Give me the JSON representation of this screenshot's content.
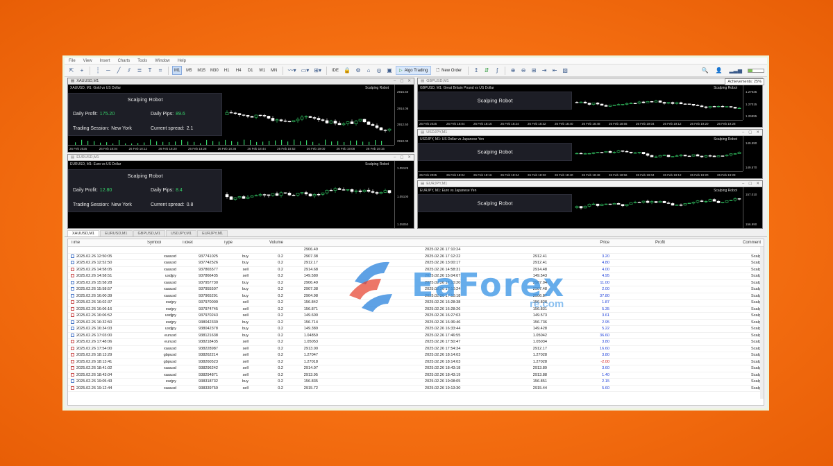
{
  "menu": [
    "File",
    "View",
    "Insert",
    "Charts",
    "Tools",
    "Window",
    "Help"
  ],
  "toolbar": {
    "timeframes": [
      "M1",
      "M5",
      "M15",
      "M30",
      "H1",
      "H4",
      "D1",
      "W1",
      "MN"
    ],
    "active_timeframe": "M1",
    "ide": "IDE",
    "algo_trading": "Algo Trading",
    "new_order": "New Order",
    "achievements_tooltip": "Achievements: 25%",
    "achievements_percent": 25
  },
  "charts": [
    {
      "window_title": "XAUUSD,M1",
      "symbol_line": "XAUUSD, M1: Gold vs US Dollar",
      "robot_tag": "Scalping Robot",
      "panel": {
        "title": "Scalping Robot",
        "daily_profit_label": "Daily Profit:",
        "daily_profit": "175.20",
        "daily_pips_label": "Daily Pips:",
        "daily_pips": "89.6",
        "session_label": "Trading Session:",
        "session": "New York",
        "spread_label": "Current spread:",
        "spread": "2.1"
      },
      "price_labels": [
        "2915.50",
        "2914.06",
        "2912.50",
        "2910.00"
      ],
      "time_labels": [
        "26 Feb 2025",
        "26 Feb 18:04",
        "26 Feb 18:12",
        "26 Feb 18:20",
        "26 Feb 18:28",
        "26 Feb 18:36",
        "26 Feb 18:44",
        "26 Feb 18:52",
        "26 Feb 19:00",
        "26 Feb 19:08",
        "26 Feb 19:16"
      ]
    },
    {
      "window_title": "EURUSD,M1",
      "symbol_line": "EURUSD, M1: Euro vs US Dollar",
      "robot_tag": "Scalping Robot",
      "panel": {
        "title": "Scalping Robot",
        "daily_profit_label": "Daily Profit:",
        "daily_profit": "12.80",
        "daily_pips_label": "Daily Pips:",
        "daily_pips": "8.4",
        "session_label": "Trading Session:",
        "session": "New York",
        "spread_label": "Current spread:",
        "spread": "0.8"
      },
      "price_labels": [
        "1.05125",
        "1.05100",
        "1.05050"
      ],
      "time_labels": []
    },
    {
      "window_title": "GBPUSD,M1",
      "symbol_line": "GBPUSD, M1: Great Britain Pound vs US Dollar",
      "robot_tag": "Scalping Robot",
      "panel": {
        "title": "Scalping Robot"
      },
      "price_labels": [
        "1.27035",
        "1.27015",
        "1.26995"
      ],
      "time_labels": [
        "26 Feb 2025",
        "26 Feb 18:04",
        "26 Feb 18:16",
        "26 Feb 18:24",
        "26 Feb 18:32",
        "26 Feb 18:40",
        "26 Feb 18:48",
        "26 Feb 18:56",
        "26 Feb 19:04",
        "26 Feb 19:12",
        "26 Feb 19:20",
        "26 Feb 19:28"
      ]
    },
    {
      "window_title": "USDJPY,M1",
      "symbol_line": "USDJPY, M1: US Dollar vs Japanese Yen",
      "robot_tag": "Scalping Robot",
      "panel": {
        "title": "Scalping Robot"
      },
      "price_labels": [
        "149.590",
        "149.570"
      ],
      "time_labels": [
        "26 Feb 2025",
        "26 Feb 18:04",
        "26 Feb 18:16",
        "26 Feb 18:24",
        "26 Feb 18:32",
        "26 Feb 18:40",
        "26 Feb 18:48",
        "26 Feb 18:56",
        "26 Feb 19:04",
        "26 Feb 19:12",
        "26 Feb 19:20",
        "26 Feb 19:28"
      ]
    },
    {
      "window_title": "EURJPY,M1",
      "symbol_line": "EURJPY, M1: Euro vs Japanese Yen",
      "robot_tag": "Scalping Robot",
      "panel": {
        "title": "Scalping Robot"
      },
      "price_labels": [
        "157.010",
        "156.990"
      ],
      "time_labels": []
    }
  ],
  "chart_tabs": [
    "XAUUSD,M1",
    "EURUSD,M1",
    "GBPUSD,M1",
    "USDJPY,M1",
    "EURJPY,M1"
  ],
  "active_chart_tab": "XAUUSD,M1",
  "terminal": {
    "columns": [
      "Time",
      "Symbol",
      "Ticket",
      "Type",
      "Volume",
      "",
      "",
      "",
      "Price",
      "Profit",
      "Comment"
    ],
    "first_row": {
      "open_price": "2906.49",
      "close_time": "2025.02.26 17:10:24"
    },
    "rows": [
      [
        "2025.02.26 12:50:05",
        "xauusd",
        "937741025",
        "buy",
        "0.2",
        "2907.38",
        "2025.02.26 17:12:22",
        "2912.41",
        "3.20",
        "Scalp"
      ],
      [
        "2025.02.26 12:52:50",
        "xauusd",
        "937742526",
        "buy",
        "0.2",
        "2912.17",
        "2025.02.26 13:00:17",
        "2912.41",
        "4.80",
        "Scalp"
      ],
      [
        "2025.02.26 14:58:05",
        "xauusd",
        "937865577",
        "sell",
        "0.2",
        "2914.68",
        "2025.02.26 14:58:31",
        "2914.48",
        "4.00",
        "Scalp"
      ],
      [
        "2025.02.26 14:58:51",
        "usdjpy",
        "937866435",
        "sell",
        "0.2",
        "149.580",
        "2025.02.26 15:04:07",
        "149.543",
        "4.95",
        "Scalp"
      ],
      [
        "2025.02.26 15:58:28",
        "xauusd",
        "937957730",
        "buy",
        "0.2",
        "2906.49",
        "2025.02.26 17:10:20",
        "2907.04",
        "11.00",
        "Scalp"
      ],
      [
        "2025.02.26 15:58:57",
        "xauusd",
        "937955507",
        "buy",
        "0.2",
        "2907.38",
        "2025.02.26 17:10:24",
        "2907.48",
        "2.00",
        "Scalp"
      ],
      [
        "2025.02.26 16:00:39",
        "xauusd",
        "937965291",
        "buy",
        "0.2",
        "2904.98",
        "2025.02.26 17:10:18",
        "2906.87",
        "37.80",
        "Scalp"
      ],
      [
        "2025.02.26 16:02:37",
        "eurjpy",
        "937970009",
        "sell",
        "0.2",
        "156.842",
        "2025.02.26 16:28:38",
        "156.828",
        "1.87",
        "Scalp"
      ],
      [
        "2025.02.26 16:06:16",
        "eurjpy",
        "937974745",
        "sell",
        "0.2",
        "156.871",
        "2025.02.26 16:28:26",
        "156.831",
        "5.35",
        "Scalp"
      ],
      [
        "2025.02.26 16:06:52",
        "usdjpy",
        "937970243",
        "sell",
        "0.2",
        "149.600",
        "2025.02.26 16:27:03",
        "149.573",
        "3.61",
        "Scalp"
      ],
      [
        "2025.02.26 16:32:50",
        "eurjpy",
        "938042339",
        "buy",
        "0.2",
        "156.714",
        "2025.02.26 16:36:46",
        "156.736",
        "2.95",
        "Scalp"
      ],
      [
        "2025.02.26 16:34:03",
        "usdjpy",
        "938042378",
        "buy",
        "0.2",
        "149.389",
        "2025.02.26 16:33:44",
        "149.428",
        "5.22",
        "Scalp"
      ],
      [
        "2025.02.26 17:03:00",
        "eurusd",
        "938121638",
        "buy",
        "0.2",
        "1.04859",
        "2025.02.26 17:46:55",
        "1.05042",
        "36.60",
        "Scalp"
      ],
      [
        "2025.02.26 17:48:06",
        "eurusd",
        "938218435",
        "sell",
        "0.2",
        "1.05053",
        "2025.02.26 17:50:47",
        "1.05034",
        "3.80",
        "Scalp"
      ],
      [
        "2025.02.26 17:54:00",
        "xauusd",
        "938228987",
        "sell",
        "0.2",
        "2913.00",
        "2025.02.26 17:54:34",
        "2912.17",
        "16.60",
        "Scalp"
      ],
      [
        "2025.02.26 18:13:29",
        "gbpusd",
        "938262214",
        "sell",
        "0.2",
        "1.27047",
        "2025.02.26 18:14:03",
        "1.27028",
        "3.80",
        "Scalp"
      ],
      [
        "2025.02.26 18:13:41",
        "gbpusd",
        "938260523",
        "sell",
        "0.2",
        "1.27018",
        "2025.02.26 18:14:03",
        "1.27028",
        "-2.00",
        "Scalp"
      ],
      [
        "2025.02.26 18:41:02",
        "xauusd",
        "938296242",
        "sell",
        "0.2",
        "2914.07",
        "2025.02.26 18:43:18",
        "2913.89",
        "3.60",
        "Scalp"
      ],
      [
        "2025.02.26 18:43:04",
        "xauusd",
        "938294871",
        "sell",
        "0.2",
        "2913.95",
        "2025.02.26 18:43:19",
        "2913.88",
        "1.40",
        "Scalp"
      ],
      [
        "2025.02.26 19:05:43",
        "eurjpy",
        "938318732",
        "buy",
        "0.2",
        "156.835",
        "2025.02.26 19:08:05",
        "156.851",
        "2.15",
        "Scalp"
      ],
      [
        "2025.02.26 19:12:44",
        "xauusd",
        "938339759",
        "sell",
        "0.2",
        "2915.72",
        "2025.02.26 19:13:30",
        "2915.44",
        "5.60",
        "Scalp"
      ]
    ]
  },
  "watermark": {
    "brand": "EaForex",
    "sub": "re.com"
  },
  "colors": {
    "green_value": "#36d46a",
    "bull_candle": "#36d46a",
    "profit_blue": "#1c3ed8",
    "loss_red": "#d41c1c"
  }
}
